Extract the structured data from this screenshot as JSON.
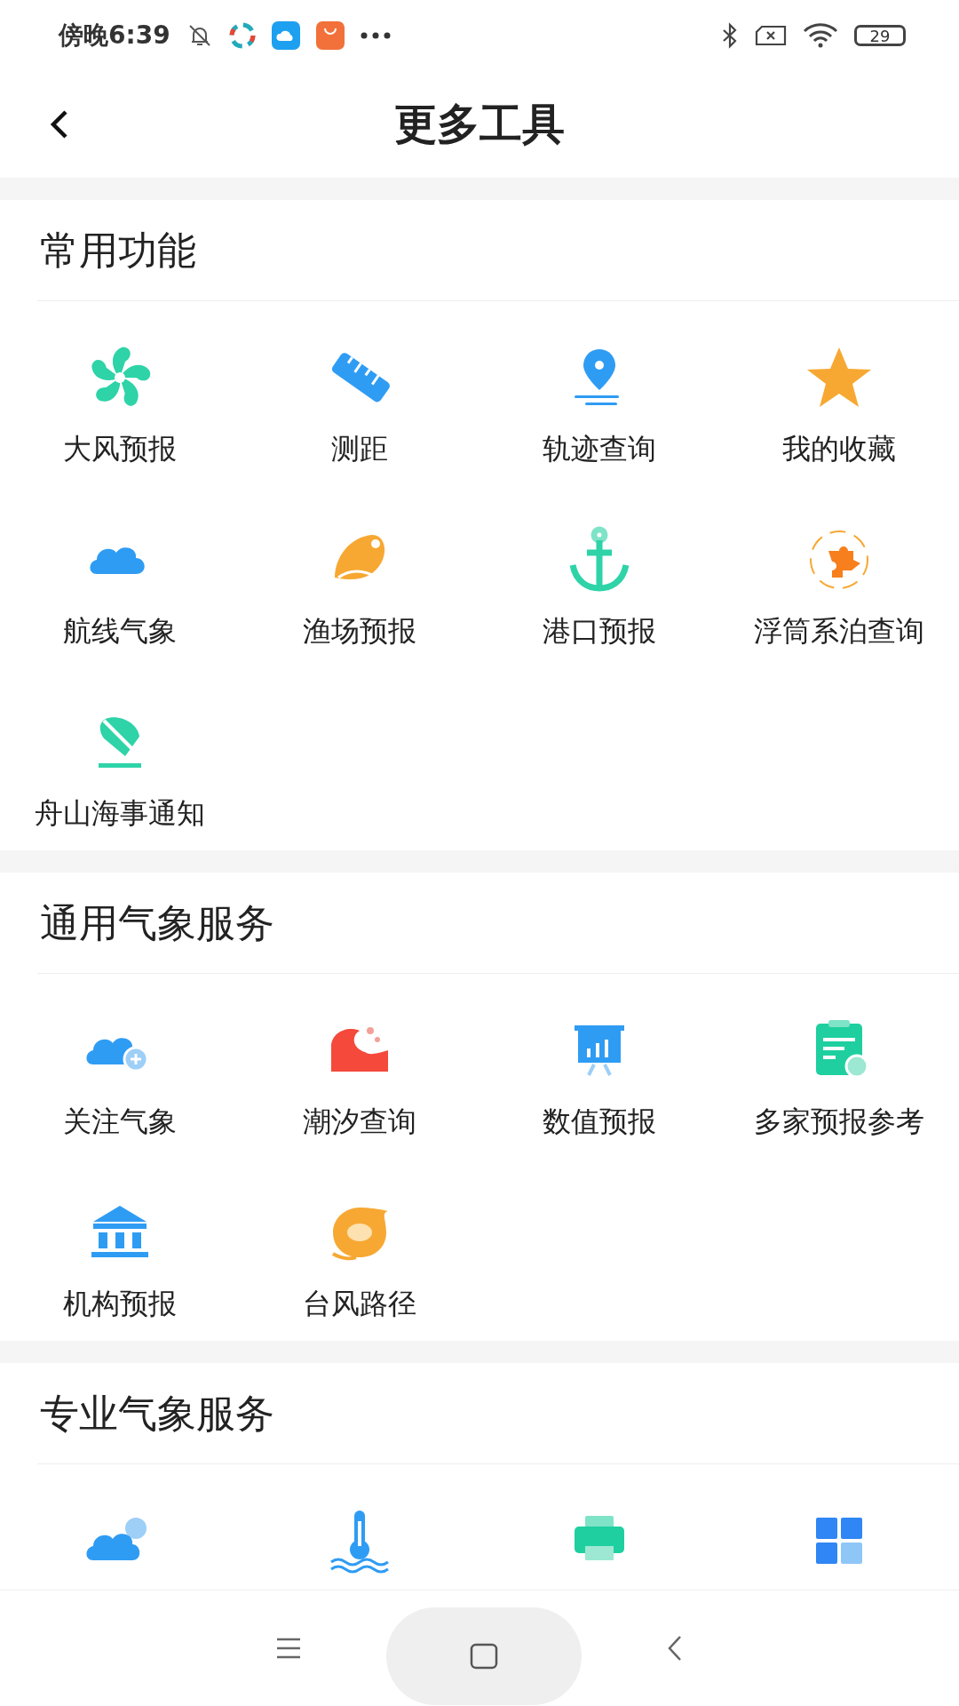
{
  "status_bar": {
    "time": "傍晚6:39",
    "battery": "29"
  },
  "header": {
    "title": "更多工具"
  },
  "sections": [
    {
      "title": "常用功能",
      "items": [
        {
          "label": "大风预报"
        },
        {
          "label": "测距"
        },
        {
          "label": "轨迹查询"
        },
        {
          "label": "我的收藏"
        },
        {
          "label": "航线气象"
        },
        {
          "label": "渔场预报"
        },
        {
          "label": "港口预报"
        },
        {
          "label": "浮筒系泊查询"
        },
        {
          "label": "舟山海事通知"
        }
      ]
    },
    {
      "title": "通用气象服务",
      "items": [
        {
          "label": "关注气象"
        },
        {
          "label": "潮汐查询"
        },
        {
          "label": "数值预报"
        },
        {
          "label": "多家预报参考"
        },
        {
          "label": "机构预报"
        },
        {
          "label": "台风路径"
        }
      ]
    },
    {
      "title": "专业气象服务"
    }
  ]
}
